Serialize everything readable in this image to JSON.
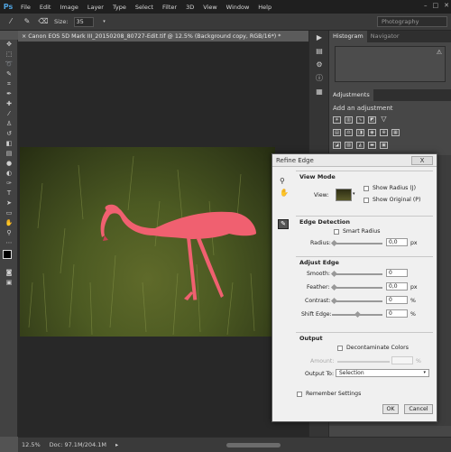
{
  "app": {
    "logo": "Ps"
  },
  "menu": [
    "File",
    "Edit",
    "Image",
    "Layer",
    "Type",
    "Select",
    "Filter",
    "3D",
    "View",
    "Window",
    "Help"
  ],
  "options": {
    "size_label": "Size:",
    "size_value": "35",
    "workspace": "Photography"
  },
  "document": {
    "tab_title": "× Canon EOS 5D Mark III_20150208_80727-Edit.tif @ 12.5% (Background copy, RGB/16*) *"
  },
  "status": {
    "zoom": "12.5%",
    "doc": "Doc: 97.1M/204.1M"
  },
  "panels": {
    "histogram_tab": "Histogram",
    "navigator_tab": "Navigator",
    "adjustments_tab": "Adjustments",
    "adjustments_title": "Add an adjustment"
  },
  "dialog": {
    "title": "Refine Edge",
    "close": "X",
    "view_mode": {
      "title": "View Mode",
      "view_label": "View:",
      "show_radius": "Show Radius (J)",
      "show_original": "Show Original (P)"
    },
    "edge_detection": {
      "title": "Edge Detection",
      "smart_radius": "Smart Radius",
      "radius_label": "Radius:",
      "radius_value": "0,0",
      "radius_unit": "px"
    },
    "adjust_edge": {
      "title": "Adjust Edge",
      "smooth_label": "Smooth:",
      "smooth_value": "0",
      "feather_label": "Feather:",
      "feather_value": "0,0",
      "feather_unit": "px",
      "contrast_label": "Contrast:",
      "contrast_value": "0",
      "contrast_unit": "%",
      "shift_label": "Shift Edge:",
      "shift_value": "0",
      "shift_unit": "%"
    },
    "output": {
      "title": "Output",
      "decontaminate": "Decontaminate Colors",
      "amount_label": "Amount:",
      "amount_unit": "%",
      "output_to_label": "Output To:",
      "output_to_value": "Selection"
    },
    "remember": "Remember Settings",
    "ok": "OK",
    "cancel": "Cancel"
  }
}
